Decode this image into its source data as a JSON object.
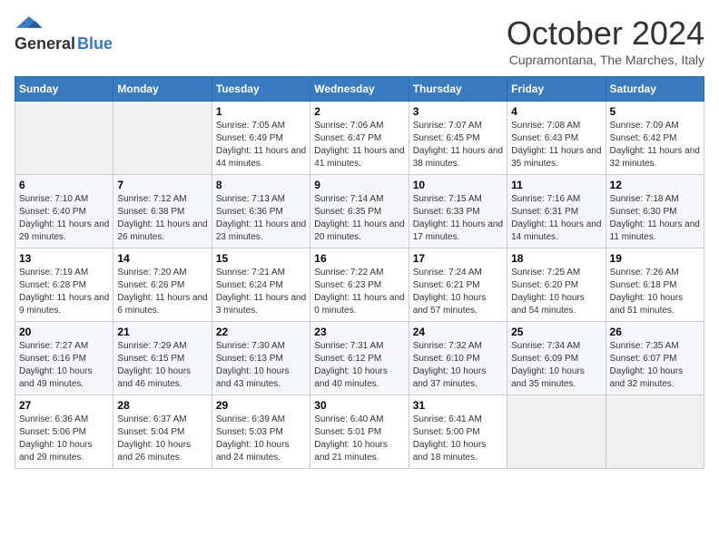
{
  "header": {
    "logo_general": "General",
    "logo_blue": "Blue",
    "month": "October 2024",
    "location": "Cupramontana, The Marches, Italy"
  },
  "days_of_week": [
    "Sunday",
    "Monday",
    "Tuesday",
    "Wednesday",
    "Thursday",
    "Friday",
    "Saturday"
  ],
  "weeks": [
    [
      {
        "day": "",
        "detail": ""
      },
      {
        "day": "",
        "detail": ""
      },
      {
        "day": "1",
        "detail": "Sunrise: 7:05 AM\nSunset: 6:49 PM\nDaylight: 11 hours and 44 minutes."
      },
      {
        "day": "2",
        "detail": "Sunrise: 7:06 AM\nSunset: 6:47 PM\nDaylight: 11 hours and 41 minutes."
      },
      {
        "day": "3",
        "detail": "Sunrise: 7:07 AM\nSunset: 6:45 PM\nDaylight: 11 hours and 38 minutes."
      },
      {
        "day": "4",
        "detail": "Sunrise: 7:08 AM\nSunset: 6:43 PM\nDaylight: 11 hours and 35 minutes."
      },
      {
        "day": "5",
        "detail": "Sunrise: 7:09 AM\nSunset: 6:42 PM\nDaylight: 11 hours and 32 minutes."
      }
    ],
    [
      {
        "day": "6",
        "detail": "Sunrise: 7:10 AM\nSunset: 6:40 PM\nDaylight: 11 hours and 29 minutes."
      },
      {
        "day": "7",
        "detail": "Sunrise: 7:12 AM\nSunset: 6:38 PM\nDaylight: 11 hours and 26 minutes."
      },
      {
        "day": "8",
        "detail": "Sunrise: 7:13 AM\nSunset: 6:36 PM\nDaylight: 11 hours and 23 minutes."
      },
      {
        "day": "9",
        "detail": "Sunrise: 7:14 AM\nSunset: 6:35 PM\nDaylight: 11 hours and 20 minutes."
      },
      {
        "day": "10",
        "detail": "Sunrise: 7:15 AM\nSunset: 6:33 PM\nDaylight: 11 hours and 17 minutes."
      },
      {
        "day": "11",
        "detail": "Sunrise: 7:16 AM\nSunset: 6:31 PM\nDaylight: 11 hours and 14 minutes."
      },
      {
        "day": "12",
        "detail": "Sunrise: 7:18 AM\nSunset: 6:30 PM\nDaylight: 11 hours and 11 minutes."
      }
    ],
    [
      {
        "day": "13",
        "detail": "Sunrise: 7:19 AM\nSunset: 6:28 PM\nDaylight: 11 hours and 9 minutes."
      },
      {
        "day": "14",
        "detail": "Sunrise: 7:20 AM\nSunset: 6:26 PM\nDaylight: 11 hours and 6 minutes."
      },
      {
        "day": "15",
        "detail": "Sunrise: 7:21 AM\nSunset: 6:24 PM\nDaylight: 11 hours and 3 minutes."
      },
      {
        "day": "16",
        "detail": "Sunrise: 7:22 AM\nSunset: 6:23 PM\nDaylight: 11 hours and 0 minutes."
      },
      {
        "day": "17",
        "detail": "Sunrise: 7:24 AM\nSunset: 6:21 PM\nDaylight: 10 hours and 57 minutes."
      },
      {
        "day": "18",
        "detail": "Sunrise: 7:25 AM\nSunset: 6:20 PM\nDaylight: 10 hours and 54 minutes."
      },
      {
        "day": "19",
        "detail": "Sunrise: 7:26 AM\nSunset: 6:18 PM\nDaylight: 10 hours and 51 minutes."
      }
    ],
    [
      {
        "day": "20",
        "detail": "Sunrise: 7:27 AM\nSunset: 6:16 PM\nDaylight: 10 hours and 49 minutes."
      },
      {
        "day": "21",
        "detail": "Sunrise: 7:29 AM\nSunset: 6:15 PM\nDaylight: 10 hours and 46 minutes."
      },
      {
        "day": "22",
        "detail": "Sunrise: 7:30 AM\nSunset: 6:13 PM\nDaylight: 10 hours and 43 minutes."
      },
      {
        "day": "23",
        "detail": "Sunrise: 7:31 AM\nSunset: 6:12 PM\nDaylight: 10 hours and 40 minutes."
      },
      {
        "day": "24",
        "detail": "Sunrise: 7:32 AM\nSunset: 6:10 PM\nDaylight: 10 hours and 37 minutes."
      },
      {
        "day": "25",
        "detail": "Sunrise: 7:34 AM\nSunset: 6:09 PM\nDaylight: 10 hours and 35 minutes."
      },
      {
        "day": "26",
        "detail": "Sunrise: 7:35 AM\nSunset: 6:07 PM\nDaylight: 10 hours and 32 minutes."
      }
    ],
    [
      {
        "day": "27",
        "detail": "Sunrise: 6:36 AM\nSunset: 5:06 PM\nDaylight: 10 hours and 29 minutes."
      },
      {
        "day": "28",
        "detail": "Sunrise: 6:37 AM\nSunset: 5:04 PM\nDaylight: 10 hours and 26 minutes."
      },
      {
        "day": "29",
        "detail": "Sunrise: 6:39 AM\nSunset: 5:03 PM\nDaylight: 10 hours and 24 minutes."
      },
      {
        "day": "30",
        "detail": "Sunrise: 6:40 AM\nSunset: 5:01 PM\nDaylight: 10 hours and 21 minutes."
      },
      {
        "day": "31",
        "detail": "Sunrise: 6:41 AM\nSunset: 5:00 PM\nDaylight: 10 hours and 18 minutes."
      },
      {
        "day": "",
        "detail": ""
      },
      {
        "day": "",
        "detail": ""
      }
    ]
  ]
}
